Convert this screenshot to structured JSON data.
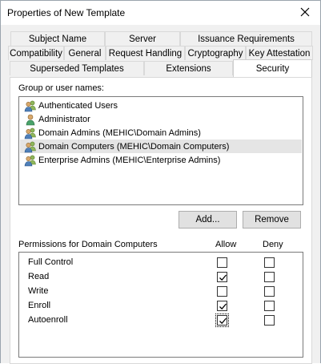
{
  "window": {
    "title": "Properties of New Template",
    "close_icon": "close-icon"
  },
  "tabs": {
    "row1": [
      {
        "label": "Subject Name"
      },
      {
        "label": "Server"
      },
      {
        "label": "Issuance Requirements"
      }
    ],
    "row2": [
      {
        "label": "Compatibility"
      },
      {
        "label": "General"
      },
      {
        "label": "Request Handling"
      },
      {
        "label": "Cryptography"
      },
      {
        "label": "Key Attestation"
      }
    ],
    "row3": [
      {
        "label": "Superseded Templates"
      },
      {
        "label": "Extensions"
      },
      {
        "label": "Security",
        "active": true
      }
    ]
  },
  "security": {
    "group_label": "Group or user names:",
    "users": [
      {
        "name": "Authenticated Users",
        "icon": "user-group-icon",
        "selected": false
      },
      {
        "name": "Administrator",
        "icon": "user-icon",
        "selected": false
      },
      {
        "name": "Domain Admins (MEHIC\\Domain Admins)",
        "icon": "user-group-icon",
        "selected": false
      },
      {
        "name": "Domain Computers (MEHIC\\Domain Computers)",
        "icon": "user-group-icon",
        "selected": true
      },
      {
        "name": "Enterprise Admins (MEHIC\\Enterprise Admins)",
        "icon": "user-group-icon",
        "selected": false
      }
    ],
    "add_label": "Add...",
    "remove_label": "Remove",
    "permissions_label": "Permissions for Domain Computers",
    "allow_header": "Allow",
    "deny_header": "Deny",
    "permissions": [
      {
        "name": "Full Control",
        "allow": false,
        "deny": false
      },
      {
        "name": "Read",
        "allow": true,
        "deny": false
      },
      {
        "name": "Write",
        "allow": false,
        "deny": false
      },
      {
        "name": "Enroll",
        "allow": true,
        "deny": false
      },
      {
        "name": "Autoenroll",
        "allow": true,
        "deny": false,
        "focused": true
      }
    ]
  }
}
